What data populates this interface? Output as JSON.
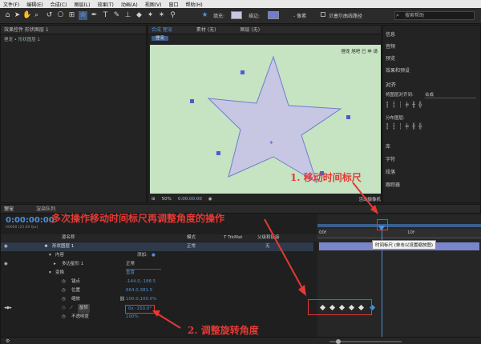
{
  "menu": [
    "文件(F)",
    "编辑(E)",
    "合成(C)",
    "图层(L)",
    "效果(T)",
    "动画(A)",
    "视图(V)",
    "窗口",
    "帮助(H)"
  ],
  "toolbar": {
    "fill_label": "填充:",
    "stroke_label": "描边:",
    "stroke_width": "- 像素",
    "align_label": "贝塞尔曲线路径",
    "search_placeholder": "搜索帮助"
  },
  "project_panel": {
    "tab": "效果控件 形状图层 1",
    "breadcrumb": "狸宠 • 形状图层 1"
  },
  "composition_panel": {
    "tab": "合成 狸宠",
    "layer_tab": "素材 (无)",
    "layer_tab2": "图层 (无)",
    "comp_name": "狸宠",
    "watermark": "狸宠 旭吧 已 申 请",
    "zoom": "50%",
    "timecode": "0:00:00:00",
    "camera": "活动摄像机"
  },
  "right_panel": {
    "items": [
      "信息",
      "音频",
      "预览",
      "效果和预设"
    ],
    "align_title": "对齐",
    "align_to_label": "将图层对齐到:",
    "align_to_value": "合成",
    "distribute_label": "分布图层:",
    "lower_items": [
      "库",
      "字符",
      "段落",
      "跟踪器"
    ]
  },
  "timeline": {
    "tab": "狸宠",
    "render_tab": "渲染队列",
    "timecode": "0:00:00:00",
    "timecode_sub": "00000 (25.00 fps)",
    "columns": {
      "source": "源名称",
      "mode": "模式",
      "trk": "T TrkMat",
      "parent": "父级和链接"
    },
    "layer_name": "形状图层 1",
    "layer_mode": "正常",
    "layer_parent": "无",
    "contents": "内容",
    "add_label": "添加:",
    "polystar": "多边星形 1",
    "polystar_mode": "正常",
    "transform": "变换",
    "reset": "重置",
    "props": [
      {
        "name": "锚点",
        "value": "-144.0,-188.5"
      },
      {
        "name": "位置",
        "value": "664.0,381.5"
      },
      {
        "name": "缩放",
        "value": "100.0,100.0%"
      },
      {
        "name": "旋转",
        "value": "0x -150.0°"
      },
      {
        "name": "不透明度",
        "value": "100%"
      }
    ],
    "ruler": {
      "start": "00f",
      "mid": "10f"
    },
    "tooltip": "时间标尺 (单击以设置缩放图)"
  },
  "annotations": {
    "step1": "1. 移动时间标尺",
    "main": "多次操作移动时间标尺再调整角度的操作",
    "step2": "2. 调整旋转角度"
  },
  "colors": {
    "comp_bg": "#c6e3c2",
    "star_fill": "#c7c7e3",
    "star_stroke": "#6f7ccf",
    "accent": "#4f8fd6",
    "annotation": "#e53935"
  },
  "keyframes_count": 6
}
